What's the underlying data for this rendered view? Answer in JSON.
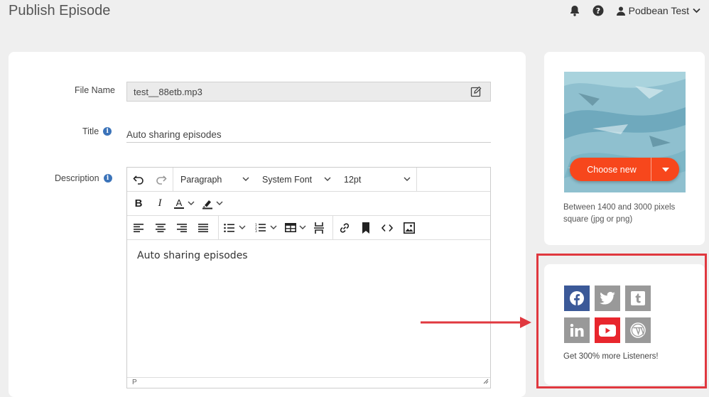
{
  "header": {
    "title": "Publish Episode",
    "user_name": "Podbean Test"
  },
  "form": {
    "file_name_label": "File Name",
    "file_name_value": "test__88etb.mp3",
    "title_label": "Title",
    "title_value": "Auto sharing episodes",
    "description_label": "Description"
  },
  "editor": {
    "block_format": "Paragraph",
    "font_family": "System Font",
    "font_size": "12pt",
    "content": "Auto sharing episodes",
    "status_path": "P"
  },
  "cover": {
    "choose_label": "Choose new",
    "hint": "Between 1400 and 3000 pixels square (jpg or png)"
  },
  "share": {
    "note": "Get 300% more Listeners!",
    "networks": [
      {
        "name": "facebook",
        "color": "#3b5998",
        "active": true
      },
      {
        "name": "twitter",
        "color": "#999999",
        "active": false
      },
      {
        "name": "tumblr",
        "color": "#999999",
        "active": false
      },
      {
        "name": "linkedin",
        "color": "#999999",
        "active": false
      },
      {
        "name": "youtube",
        "color": "#e8262d",
        "active": true
      },
      {
        "name": "wordpress",
        "color": "#999999",
        "active": false
      }
    ]
  },
  "colors": {
    "accent": "#f7471c",
    "highlight": "#e0383f",
    "info": "#3b73b9"
  }
}
